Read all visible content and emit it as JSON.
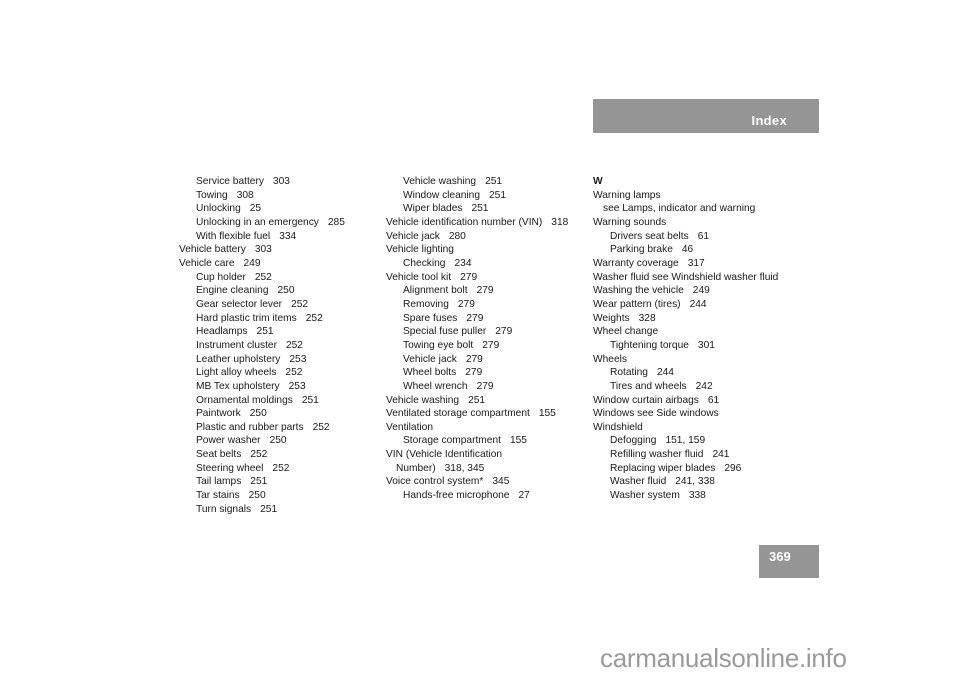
{
  "header": {
    "title": "Index"
  },
  "page_number": "369",
  "watermark": "carmanualsonline.info",
  "columns": [
    {
      "entries": [
        {
          "level": 1,
          "text": "Service battery",
          "pages": "303"
        },
        {
          "level": 1,
          "text": "Towing",
          "pages": "308"
        },
        {
          "level": 1,
          "text": "Unlocking",
          "pages": "25"
        },
        {
          "level": 1,
          "text": "Unlocking in an emergency",
          "pages": "285"
        },
        {
          "level": 1,
          "text": "With flexible fuel",
          "pages": "334"
        },
        {
          "level": 0,
          "text": "Vehicle battery",
          "pages": "303"
        },
        {
          "level": 0,
          "text": "Vehicle care",
          "pages": "249"
        },
        {
          "level": 1,
          "text": "Cup holder",
          "pages": "252"
        },
        {
          "level": 1,
          "text": "Engine cleaning",
          "pages": "250"
        },
        {
          "level": 1,
          "text": "Gear selector lever",
          "pages": "252"
        },
        {
          "level": 1,
          "text": "Hard plastic trim items",
          "pages": "252"
        },
        {
          "level": 1,
          "text": "Headlamps",
          "pages": "251"
        },
        {
          "level": 1,
          "text": "Instrument cluster",
          "pages": "252"
        },
        {
          "level": 1,
          "text": "Leather upholstery",
          "pages": "253"
        },
        {
          "level": 1,
          "text": "Light alloy wheels",
          "pages": "252"
        },
        {
          "level": 1,
          "text": "MB Tex upholstery",
          "pages": "253"
        },
        {
          "level": 1,
          "text": "Ornamental moldings",
          "pages": "251"
        },
        {
          "level": 1,
          "text": "Paintwork",
          "pages": "250"
        },
        {
          "level": 1,
          "text": "Plastic and rubber parts",
          "pages": "252"
        },
        {
          "level": 1,
          "text": "Power washer",
          "pages": "250"
        },
        {
          "level": 1,
          "text": "Seat belts",
          "pages": "252"
        },
        {
          "level": 1,
          "text": "Steering wheel",
          "pages": "252"
        },
        {
          "level": 1,
          "text": "Tail lamps",
          "pages": "251"
        },
        {
          "level": 1,
          "text": "Tar stains",
          "pages": "250"
        },
        {
          "level": 1,
          "text": "Turn signals",
          "pages": "251"
        }
      ]
    },
    {
      "entries": [
        {
          "level": 1,
          "text": "Vehicle washing",
          "pages": "251"
        },
        {
          "level": 1,
          "text": "Window cleaning",
          "pages": "251"
        },
        {
          "level": 1,
          "text": "Wiper blades",
          "pages": "251"
        },
        {
          "level": 0,
          "text": "Vehicle identification number (VIN)",
          "pages": "318"
        },
        {
          "level": 0,
          "text": "Vehicle jack",
          "pages": "280"
        },
        {
          "level": 0,
          "text": "Vehicle lighting",
          "pages": ""
        },
        {
          "level": 1,
          "text": "Checking",
          "pages": "234"
        },
        {
          "level": 0,
          "text": "Vehicle tool kit",
          "pages": "279"
        },
        {
          "level": 1,
          "text": "Alignment bolt",
          "pages": "279"
        },
        {
          "level": 1,
          "text": "Removing",
          "pages": "279"
        },
        {
          "level": 1,
          "text": "Spare fuses",
          "pages": "279"
        },
        {
          "level": 1,
          "text": "Special fuse puller",
          "pages": "279"
        },
        {
          "level": 1,
          "text": "Towing eye bolt",
          "pages": "279"
        },
        {
          "level": 1,
          "text": "Vehicle jack",
          "pages": "279"
        },
        {
          "level": 1,
          "text": "Wheel bolts",
          "pages": "279"
        },
        {
          "level": 1,
          "text": "Wheel wrench",
          "pages": "279"
        },
        {
          "level": 0,
          "text": "Vehicle washing",
          "pages": "251"
        },
        {
          "level": 0,
          "text": "Ventilated storage compartment",
          "pages": "155"
        },
        {
          "level": 0,
          "text": "Ventilation",
          "pages": ""
        },
        {
          "level": 1,
          "text": "Storage compartment",
          "pages": "155"
        },
        {
          "level": 0,
          "text": "VIN (Vehicle Identification",
          "pages": ""
        },
        {
          "level": 2,
          "text": "Number)",
          "pages": "318, 345"
        },
        {
          "level": 0,
          "text": "Voice control system*",
          "pages": "345"
        },
        {
          "level": 1,
          "text": "Hands-free microphone",
          "pages": "27"
        }
      ]
    },
    {
      "entries": [
        {
          "level": -1,
          "text": "W",
          "pages": ""
        },
        {
          "level": 0,
          "text": "Warning lamps",
          "pages": ""
        },
        {
          "level": 2,
          "text": "see Lamps, indicator and warning",
          "pages": ""
        },
        {
          "level": 0,
          "text": "Warning sounds",
          "pages": ""
        },
        {
          "level": 1,
          "text": "Drivers seat belts",
          "pages": "61"
        },
        {
          "level": 1,
          "text": "Parking brake",
          "pages": "46"
        },
        {
          "level": 0,
          "text": "Warranty coverage",
          "pages": "317"
        },
        {
          "level": 0,
          "text": "Washer fluid see Windshield washer fluid",
          "pages": ""
        },
        {
          "level": 0,
          "text": "Washing the vehicle",
          "pages": "249"
        },
        {
          "level": 0,
          "text": "Wear pattern (tires)",
          "pages": "244"
        },
        {
          "level": 0,
          "text": "Weights",
          "pages": "328"
        },
        {
          "level": 0,
          "text": "Wheel change",
          "pages": ""
        },
        {
          "level": 1,
          "text": "Tightening torque",
          "pages": "301"
        },
        {
          "level": 0,
          "text": "Wheels",
          "pages": ""
        },
        {
          "level": 1,
          "text": "Rotating",
          "pages": "244"
        },
        {
          "level": 1,
          "text": "Tires and wheels",
          "pages": "242"
        },
        {
          "level": 0,
          "text": "Window curtain airbags",
          "pages": "61"
        },
        {
          "level": 0,
          "text": "Windows see Side windows",
          "pages": ""
        },
        {
          "level": 0,
          "text": "Windshield",
          "pages": ""
        },
        {
          "level": 1,
          "text": "Defogging",
          "pages": "151, 159"
        },
        {
          "level": 1,
          "text": "Refilling washer fluid",
          "pages": "241"
        },
        {
          "level": 1,
          "text": "Replacing wiper blades",
          "pages": "296"
        },
        {
          "level": 1,
          "text": "Washer fluid",
          "pages": "241, 338"
        },
        {
          "level": 1,
          "text": "Washer system",
          "pages": "338"
        }
      ]
    }
  ]
}
